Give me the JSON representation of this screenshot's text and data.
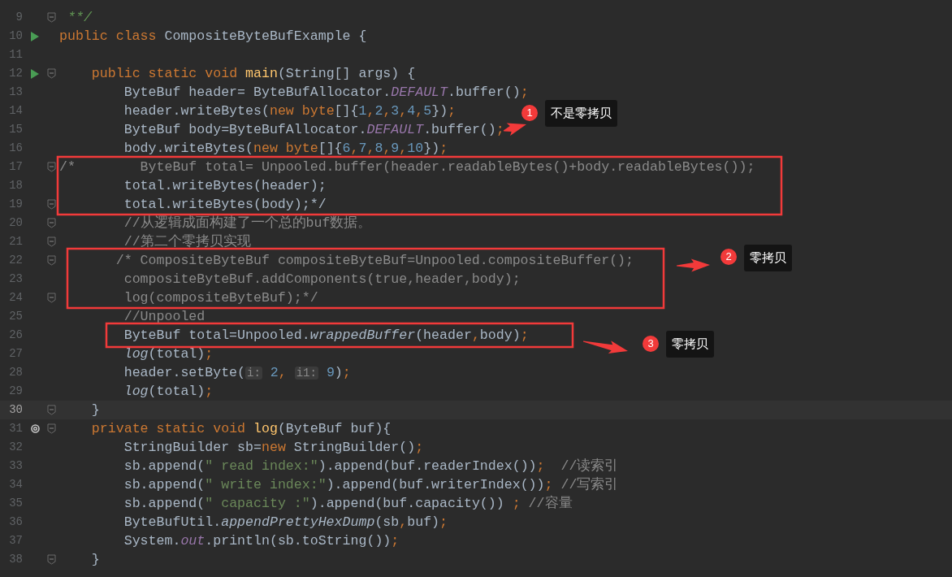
{
  "editor": {
    "lines": [
      {
        "number": "9",
        "fold": true,
        "current": false,
        "code": [
          {
            "kind": "doc",
            "text": " **/"
          }
        ]
      },
      {
        "number": "10",
        "run_marker": true,
        "fold": false,
        "current": false,
        "code": [
          {
            "kind": "keyword",
            "text": "public class "
          },
          {
            "kind": "plain",
            "text": "CompositeByteBufExample {"
          }
        ]
      },
      {
        "number": "11",
        "fold": false,
        "current": false
      },
      {
        "number": "12",
        "run_marker": true,
        "fold": true,
        "current": false,
        "code": [
          {
            "kind": "keyword",
            "text": "    public static void "
          },
          {
            "kind": "declaration",
            "text": "main"
          },
          {
            "kind": "plain",
            "text": "(String[] args) {"
          }
        ]
      },
      {
        "number": "13",
        "fold": false,
        "current": false,
        "code": [
          {
            "kind": "plain",
            "text": "        ByteBuf header= ByteBufAllocator."
          },
          {
            "kind": "constant",
            "text": "DEFAULT"
          },
          {
            "kind": "plain",
            "text": ".buffer()"
          },
          {
            "kind": "keyword",
            "text": ";"
          }
        ]
      },
      {
        "number": "14",
        "fold": false,
        "current": false,
        "code": [
          {
            "kind": "plain",
            "text": "        header.writeBytes("
          },
          {
            "kind": "keyword",
            "text": "new byte"
          },
          {
            "kind": "plain",
            "text": "[]{"
          },
          {
            "kind": "number",
            "text": "1"
          },
          {
            "kind": "keyword",
            "text": ","
          },
          {
            "kind": "number",
            "text": "2"
          },
          {
            "kind": "keyword",
            "text": ","
          },
          {
            "kind": "number",
            "text": "3"
          },
          {
            "kind": "keyword",
            "text": ","
          },
          {
            "kind": "number",
            "text": "4"
          },
          {
            "kind": "keyword",
            "text": ","
          },
          {
            "kind": "number",
            "text": "5"
          },
          {
            "kind": "plain",
            "text": "})"
          },
          {
            "kind": "keyword",
            "text": ";"
          }
        ]
      },
      {
        "number": "15",
        "fold": false,
        "current": false,
        "code": [
          {
            "kind": "plain",
            "text": "        ByteBuf body=ByteBufAllocator."
          },
          {
            "kind": "constant",
            "text": "DEFAULT"
          },
          {
            "kind": "plain",
            "text": ".buffer()"
          },
          {
            "kind": "keyword",
            "text": ";"
          }
        ]
      },
      {
        "number": "16",
        "fold": false,
        "current": false,
        "code": [
          {
            "kind": "plain",
            "text": "        body.writeBytes("
          },
          {
            "kind": "keyword",
            "text": "new byte"
          },
          {
            "kind": "plain",
            "text": "[]{"
          },
          {
            "kind": "number",
            "text": "6"
          },
          {
            "kind": "keyword",
            "text": ","
          },
          {
            "kind": "number",
            "text": "7"
          },
          {
            "kind": "keyword",
            "text": ","
          },
          {
            "kind": "number",
            "text": "8"
          },
          {
            "kind": "keyword",
            "text": ","
          },
          {
            "kind": "number",
            "text": "9"
          },
          {
            "kind": "keyword",
            "text": ","
          },
          {
            "kind": "number",
            "text": "10"
          },
          {
            "kind": "plain",
            "text": "})"
          },
          {
            "kind": "keyword",
            "text": ";"
          }
        ]
      },
      {
        "number": "17",
        "fold": true,
        "current": false,
        "code": [
          {
            "kind": "comment",
            "text": "/*        ByteBuf total= Unpooled.buffer(header.readableBytes()+body.readableBytes());"
          }
        ]
      },
      {
        "number": "18",
        "fold": false,
        "current": false,
        "code": [
          {
            "kind": "plain",
            "text": "        total.writeBytes(header);"
          }
        ]
      },
      {
        "number": "19",
        "fold": true,
        "current": false,
        "code": [
          {
            "kind": "plain",
            "text": "        total.writeBytes(body);*/"
          }
        ]
      },
      {
        "number": "20",
        "fold": true,
        "current": false,
        "code": [
          {
            "kind": "comment",
            "text": "        //从逻辑成面构建了一个总的buf数据。"
          }
        ]
      },
      {
        "number": "21",
        "fold": true,
        "current": false,
        "code": [
          {
            "kind": "comment",
            "text": "        //第二个零拷贝实现"
          }
        ]
      },
      {
        "number": "22",
        "fold": true,
        "current": false,
        "code": [
          {
            "kind": "comment",
            "text": "       /* CompositeByteBuf compositeByteBuf=Unpooled.compositeBuffer();"
          }
        ]
      },
      {
        "number": "23",
        "fold": false,
        "current": false,
        "code": [
          {
            "kind": "comment",
            "text": "        compositeByteBuf.addComponents(true,header,body);"
          }
        ]
      },
      {
        "number": "24",
        "fold": true,
        "current": false,
        "code": [
          {
            "kind": "comment",
            "text": "        log(compositeByteBuf);*/"
          }
        ]
      },
      {
        "number": "25",
        "fold": false,
        "current": false,
        "code": [
          {
            "kind": "comment",
            "text": "        //Unpooled"
          }
        ]
      },
      {
        "number": "26",
        "fold": false,
        "current": false,
        "code": [
          {
            "kind": "plain",
            "text": "        ByteBuf total=Unpooled."
          },
          {
            "kind": "static_call",
            "text": "wrappedBuffer"
          },
          {
            "kind": "plain",
            "text": "(header"
          },
          {
            "kind": "keyword",
            "text": ","
          },
          {
            "kind": "plain",
            "text": "body)"
          },
          {
            "kind": "keyword",
            "text": ";"
          }
        ]
      },
      {
        "number": "27",
        "fold": false,
        "current": false,
        "code": [
          {
            "kind": "static_call",
            "text": "        log"
          },
          {
            "kind": "plain",
            "text": "(total)"
          },
          {
            "kind": "keyword",
            "text": ";"
          }
        ]
      },
      {
        "number": "28",
        "fold": false,
        "current": false,
        "code": [
          {
            "kind": "plain",
            "text": "        header.setByte("
          },
          {
            "kind": "hint",
            "text": "i:"
          },
          {
            "kind": "number",
            "text": " 2"
          },
          {
            "kind": "keyword",
            "text": ", "
          },
          {
            "kind": "hint",
            "text": "i1:"
          },
          {
            "kind": "number",
            "text": " 9"
          },
          {
            "kind": "plain",
            "text": ")"
          },
          {
            "kind": "keyword",
            "text": ";"
          }
        ]
      },
      {
        "number": "29",
        "fold": false,
        "current": false,
        "code": [
          {
            "kind": "static_call",
            "text": "        log"
          },
          {
            "kind": "plain",
            "text": "(total)"
          },
          {
            "kind": "keyword",
            "text": ";"
          }
        ]
      },
      {
        "number": "30",
        "fold": true,
        "current": true,
        "code": [
          {
            "kind": "plain",
            "text": "    }"
          }
        ]
      },
      {
        "number": "31",
        "override_marker": true,
        "fold": true,
        "current": false,
        "code": [
          {
            "kind": "keyword",
            "text": "    private static void "
          },
          {
            "kind": "declaration",
            "text": "log"
          },
          {
            "kind": "plain",
            "text": "(ByteBuf buf){"
          }
        ]
      },
      {
        "number": "32",
        "fold": false,
        "current": false,
        "code": [
          {
            "kind": "plain",
            "text": "        StringBuilder sb="
          },
          {
            "kind": "keyword",
            "text": "new "
          },
          {
            "kind": "plain",
            "text": "StringBuilder()"
          },
          {
            "kind": "keyword",
            "text": ";"
          }
        ]
      },
      {
        "number": "33",
        "fold": false,
        "current": false,
        "code": [
          {
            "kind": "plain",
            "text": "        sb.append("
          },
          {
            "kind": "string",
            "text": "\" read index:\""
          },
          {
            "kind": "plain",
            "text": ").append(buf.readerIndex())"
          },
          {
            "kind": "keyword",
            "text": ";  "
          },
          {
            "kind": "comment",
            "text": "//读索引"
          }
        ]
      },
      {
        "number": "34",
        "fold": false,
        "current": false,
        "code": [
          {
            "kind": "plain",
            "text": "        sb.append("
          },
          {
            "kind": "string",
            "text": "\" write index:\""
          },
          {
            "kind": "plain",
            "text": ").append(buf.writerIndex())"
          },
          {
            "kind": "keyword",
            "text": "; "
          },
          {
            "kind": "comment",
            "text": "//写索引"
          }
        ]
      },
      {
        "number": "35",
        "fold": false,
        "current": false,
        "code": [
          {
            "kind": "plain",
            "text": "        sb.append("
          },
          {
            "kind": "string",
            "text": "\" capacity :\""
          },
          {
            "kind": "plain",
            "text": ").append(buf.capacity()) "
          },
          {
            "kind": "keyword",
            "text": "; "
          },
          {
            "kind": "comment",
            "text": "//容量"
          }
        ]
      },
      {
        "number": "36",
        "fold": false,
        "current": false,
        "code": [
          {
            "kind": "plain",
            "text": "        ByteBufUtil."
          },
          {
            "kind": "static_call",
            "text": "appendPrettyHexDump"
          },
          {
            "kind": "plain",
            "text": "(sb"
          },
          {
            "kind": "keyword",
            "text": ","
          },
          {
            "kind": "plain",
            "text": "buf)"
          },
          {
            "kind": "keyword",
            "text": ";"
          }
        ]
      },
      {
        "number": "37",
        "fold": false,
        "current": false,
        "code": [
          {
            "kind": "plain",
            "text": "        System."
          },
          {
            "kind": "constant",
            "text": "out"
          },
          {
            "kind": "plain",
            "text": ".println(sb.toString())"
          },
          {
            "kind": "keyword",
            "text": ";"
          }
        ]
      },
      {
        "number": "38",
        "fold": true,
        "current": false,
        "code": [
          {
            "kind": "plain",
            "text": "    }"
          }
        ]
      }
    ]
  },
  "annotations": [
    {
      "number": "1",
      "label": "不是零拷贝"
    },
    {
      "number": "2",
      "label": "零拷贝"
    },
    {
      "number": "3",
      "label": "零拷贝"
    }
  ]
}
